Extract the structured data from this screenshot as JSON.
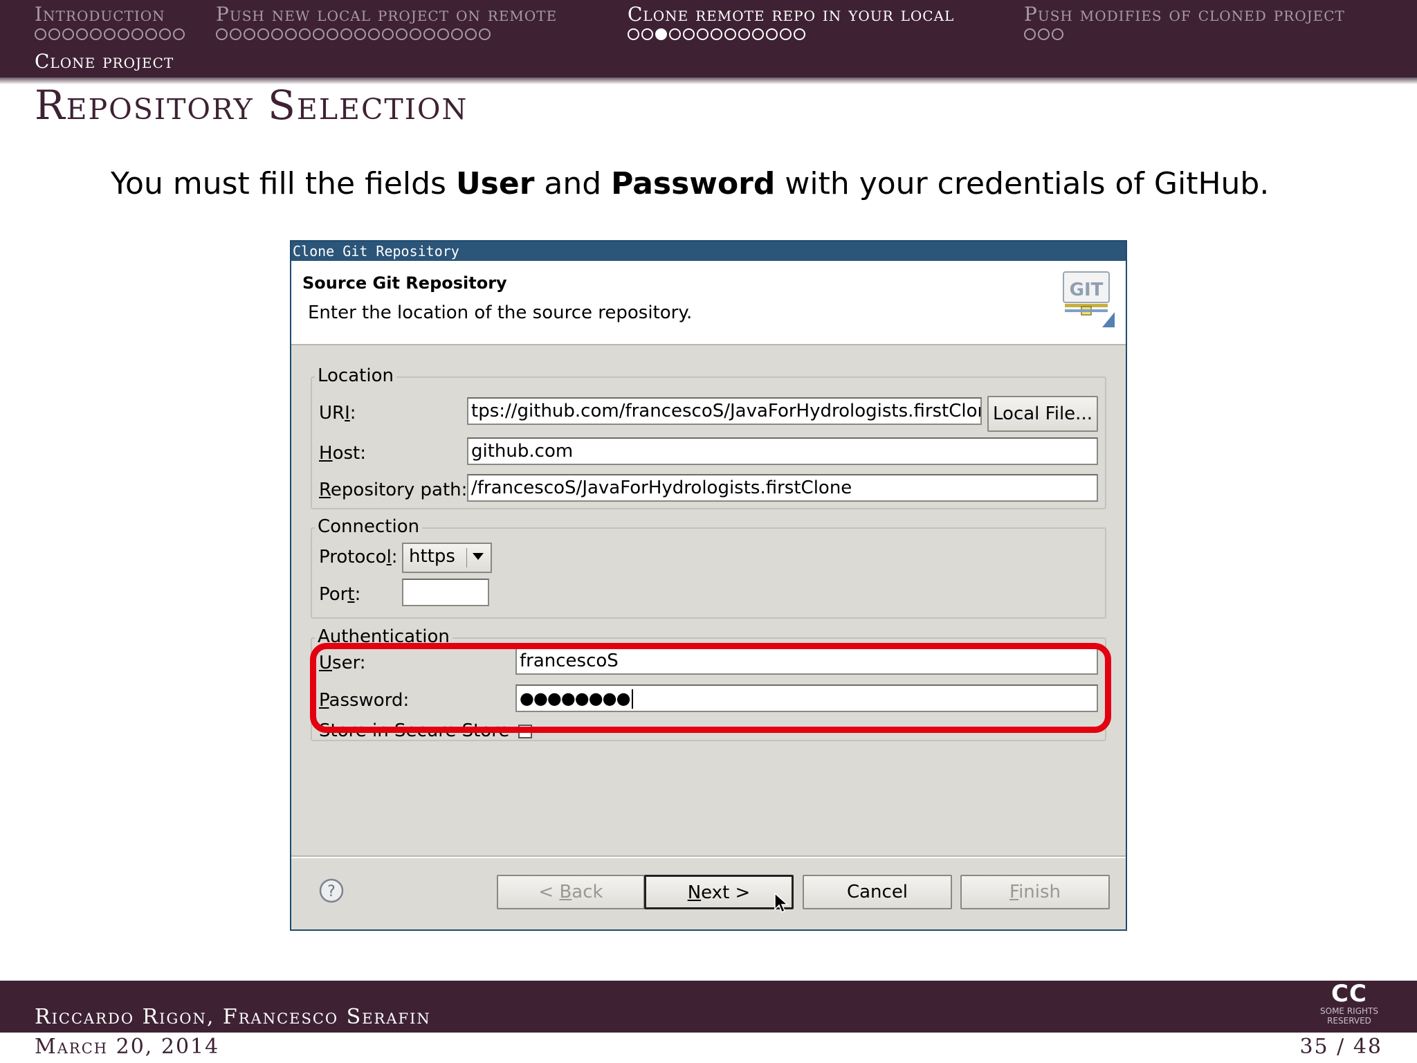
{
  "header": {
    "sections": [
      {
        "label": "Introduction",
        "dots": 11,
        "filled": -1,
        "active": false
      },
      {
        "label": "Push new local project on remote",
        "dots": 20,
        "filled": -1,
        "active": false
      },
      {
        "label": "Clone remote repo in your local",
        "dots": 13,
        "filled": 2,
        "active": true
      },
      {
        "label": "Push modifies of cloned project",
        "dots": 3,
        "filled": -1,
        "active": false
      }
    ],
    "subsection": "Clone project"
  },
  "slide": {
    "title": "Repository Selection",
    "lead_pre": "You must fill the fields ",
    "lead_bold1": "User",
    "lead_mid": " and ",
    "lead_bold2": "Password",
    "lead_post": " with your credentials of GitHub."
  },
  "dialog": {
    "window_title": "Clone Git Repository",
    "banner_title": "Source Git Repository",
    "banner_desc": "Enter the location of the source repository.",
    "git_logo_text": "GIT",
    "location": {
      "legend": "Location",
      "uri_label_pre": "UR",
      "uri_label_u": "I",
      "uri_label_post": ":",
      "uri_value": "tps://github.com/francescoS/JavaForHydrologists.firstClone",
      "local_file_button": "Local File...",
      "host_label_u": "H",
      "host_label_post": "ost:",
      "host_value": "github.com",
      "repo_label_u": "R",
      "repo_label_post": "epository path:",
      "repo_value": "/francescoS/JavaForHydrologists.firstClone"
    },
    "connection": {
      "legend": "Connection",
      "protocol_label_pre": "Protoco",
      "protocol_label_u": "l",
      "protocol_label_post": ":",
      "protocol_value": "https",
      "port_label_pre": "Por",
      "port_label_u": "t",
      "port_label_post": ":",
      "port_value": ""
    },
    "authentication": {
      "legend": "Authentication",
      "user_label_u": "U",
      "user_label_post": "ser:",
      "user_value": "francescoS",
      "password_label_u": "P",
      "password_label_post": "assword:",
      "password_value": "●●●●●●●●",
      "store_label": "Store in Secure Store",
      "store_checked": false
    },
    "buttons": {
      "back_pre": "< ",
      "back_u": "B",
      "back_post": "ack",
      "next_u": "N",
      "next_post": "ext >",
      "cancel": "Cancel",
      "finish_u": "F",
      "finish_post": "inish"
    },
    "help_glyph": "?"
  },
  "footer": {
    "authors": "Riccardo Rigon, Francesco Serafin",
    "date": "March 20, 2014",
    "page": "35 / 48",
    "cc_big": "CC",
    "cc_small": "SOME RIGHTS RESERVED"
  },
  "colors": {
    "beamer_bg": "#3e2233",
    "dialog_title_bg": "#2b5579",
    "highlight": "#e3000f"
  }
}
